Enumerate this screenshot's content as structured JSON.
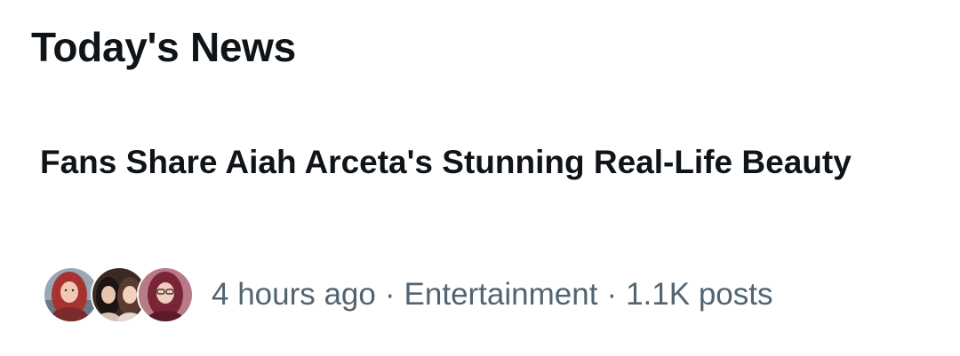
{
  "section": {
    "title": "Today's News"
  },
  "news_item": {
    "headline": "Fans Share Aiah Arceta's Stunning Real-Life Beauty",
    "time": "4 hours ago",
    "separator": "·",
    "category": "Entertainment",
    "post_count": "1.1K posts",
    "avatars": [
      {
        "icon": "person-photo-red-hair",
        "bg": "#9aa7b5",
        "hair": "#a8322f"
      },
      {
        "icon": "person-photo-group",
        "bg": "#3a2a25",
        "hair": "#1c1412"
      },
      {
        "icon": "person-photo-glasses",
        "bg": "#b87a86",
        "hair": "#7a2438"
      }
    ]
  },
  "colors": {
    "primary_text": "#0f1419",
    "secondary_text": "#536471",
    "background": "#ffffff"
  }
}
